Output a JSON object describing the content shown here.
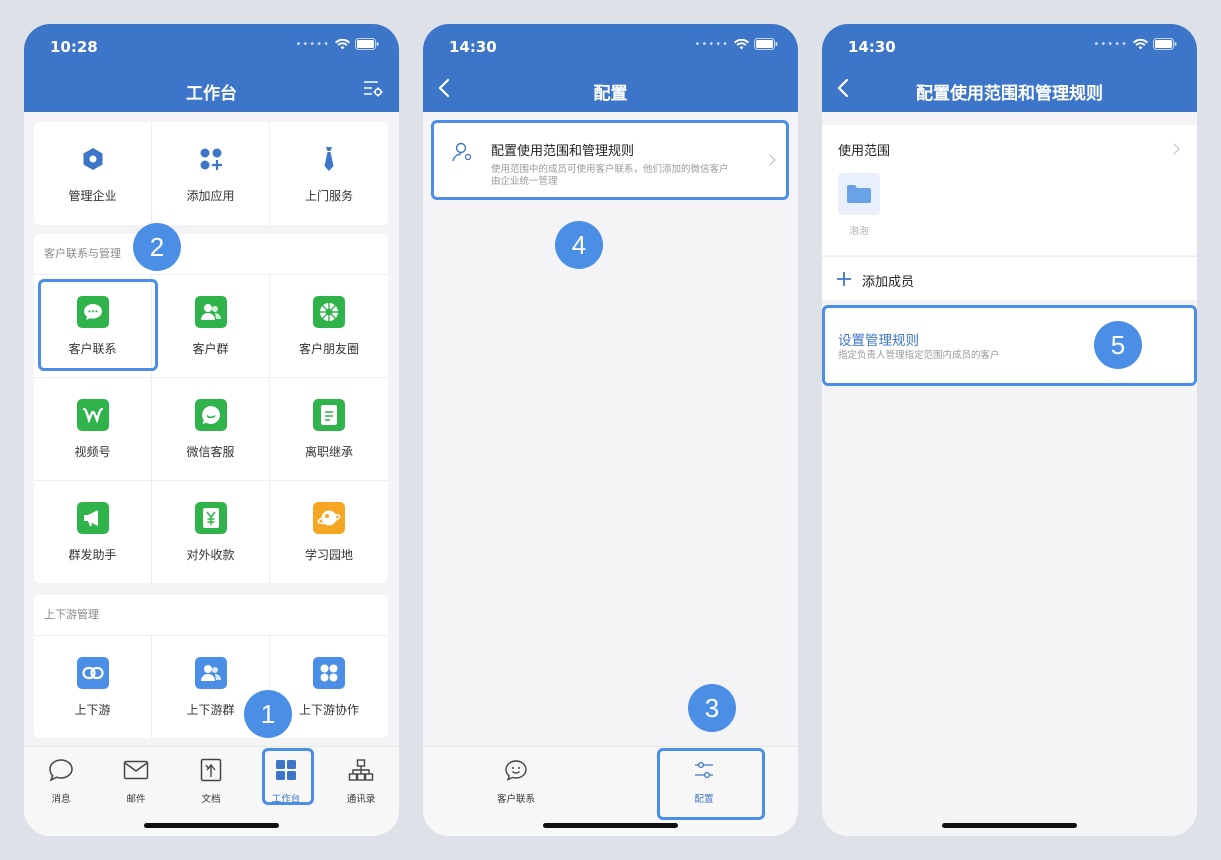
{
  "phone1": {
    "time": "10:28",
    "title": "工作台",
    "top_apps": [
      {
        "label": "管理企业",
        "icon": "hexagon-icon",
        "color": "#3d76c8"
      },
      {
        "label": "添加应用",
        "icon": "add-apps-icon",
        "color": "#3d76c8"
      },
      {
        "label": "上门服务",
        "icon": "tie-icon",
        "color": "#3d76c8"
      }
    ],
    "section1_title": "客户联系与管理",
    "section1_apps": [
      {
        "label": "客户联系",
        "icon": "chat-bubble-icon",
        "color": "#2fb34a"
      },
      {
        "label": "客户群",
        "icon": "group-icon",
        "color": "#2fb34a"
      },
      {
        "label": "客户朋友圈",
        "icon": "aperture-icon",
        "color": "#2fb34a"
      },
      {
        "label": "视频号",
        "icon": "channels-icon",
        "color": "#2fb34a"
      },
      {
        "label": "微信客服",
        "icon": "service-bubble-icon",
        "color": "#2fb34a"
      },
      {
        "label": "离职继承",
        "icon": "document-icon",
        "color": "#2fb34a"
      },
      {
        "label": "群发助手",
        "icon": "megaphone-icon",
        "color": "#2fb34a"
      },
      {
        "label": "对外收款",
        "icon": "yuan-icon",
        "color": "#2fb34a"
      },
      {
        "label": "学习园地",
        "icon": "planet-icon",
        "color": "#f5a623"
      }
    ],
    "section2_title": "上下游管理",
    "section2_apps": [
      {
        "label": "上下游",
        "icon": "link-icon",
        "color": "#4a8ee6"
      },
      {
        "label": "上下游群",
        "icon": "group-icon",
        "color": "#4a8ee6"
      },
      {
        "label": "上下游协作",
        "icon": "grid-four-icon",
        "color": "#4a8ee6"
      }
    ],
    "tabs": [
      {
        "label": "消息",
        "icon": "message-icon"
      },
      {
        "label": "邮件",
        "icon": "mail-icon"
      },
      {
        "label": "文档",
        "icon": "doc-icon"
      },
      {
        "label": "工作台",
        "icon": "workbench-icon"
      },
      {
        "label": "通讯录",
        "icon": "contacts-icon"
      }
    ],
    "badge_1": "1",
    "badge_2": "2"
  },
  "phone2": {
    "time": "14:30",
    "title": "配置",
    "row_title": "配置使用范围和管理规则",
    "row_desc_line1": "使用范围中的成员可使用客户联系，他们添加的微信客户",
    "row_desc_line2": "由企业统一管理",
    "tabs": [
      {
        "label": "客户联系",
        "icon": "smile-bubble-icon"
      },
      {
        "label": "配置",
        "icon": "sliders-icon"
      }
    ],
    "badge_3": "3",
    "badge_4": "4"
  },
  "phone3": {
    "time": "14:30",
    "title": "配置使用范围和管理规则",
    "scope_label": "使用范围",
    "folder_name": "泡泡",
    "add_member": "添加成员",
    "rule_title": "设置管理规则",
    "rule_desc": "指定负责人管理指定范围内成员的客户",
    "badge_5": "5",
    "accent": "#3d76c8"
  }
}
